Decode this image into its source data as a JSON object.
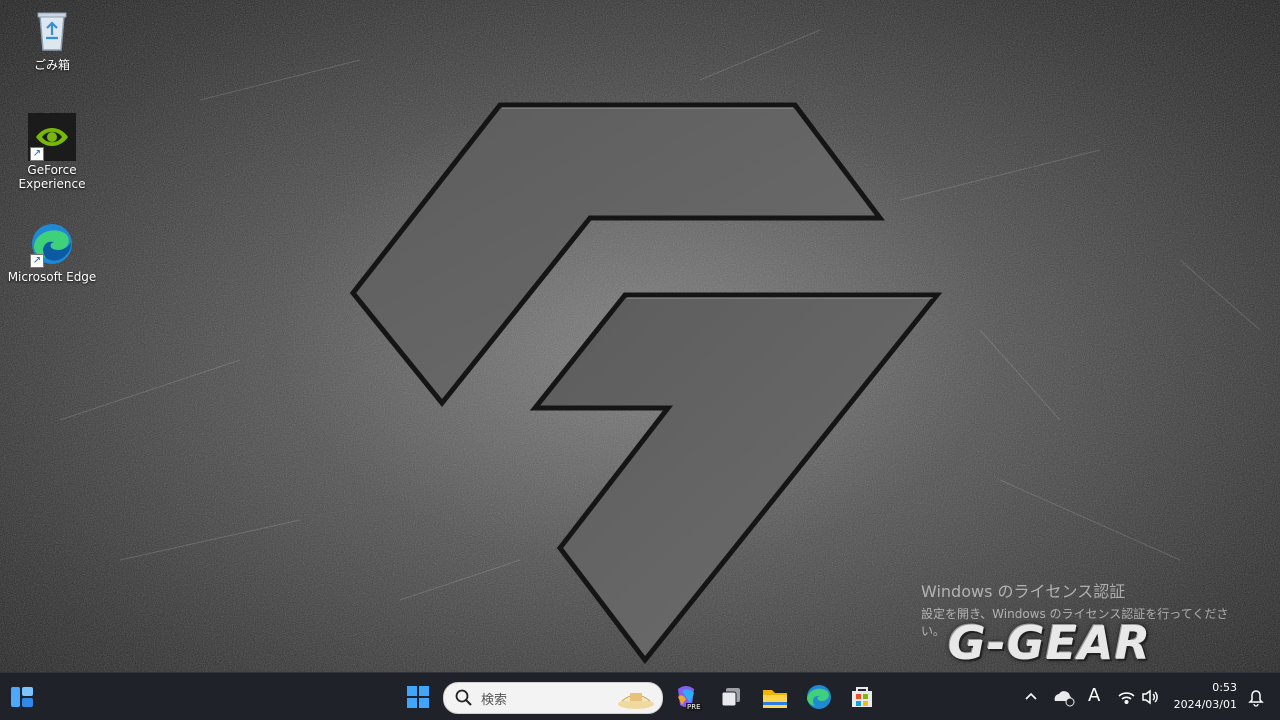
{
  "desktop": {
    "icons": [
      {
        "label": "ごみ箱",
        "icon": "recycle-bin-icon"
      },
      {
        "label": "GeForce Experience",
        "icon": "nvidia-geforce-icon"
      },
      {
        "label": "Microsoft Edge",
        "icon": "edge-icon"
      }
    ],
    "watermark": {
      "title": "Windows のライセンス認証",
      "subtitle": "設定を開き、Windows のライセンス認証を行ってください。"
    },
    "brand": "G-GEAR"
  },
  "taskbar": {
    "search_placeholder": "検索",
    "pinned": [
      {
        "icon": "start-icon"
      },
      {
        "icon": "search-icon"
      },
      {
        "icon": "copilot-icon",
        "badge": "PRE"
      },
      {
        "icon": "task-view-icon"
      },
      {
        "icon": "file-explorer-icon"
      },
      {
        "icon": "edge-icon"
      },
      {
        "icon": "microsoft-store-icon"
      }
    ],
    "tray": {
      "ime": "A",
      "time": "0:53",
      "date": "2024/03/01"
    },
    "colors": {
      "taskbar_bg": "#1f2229",
      "accent": "#0078d4"
    }
  }
}
